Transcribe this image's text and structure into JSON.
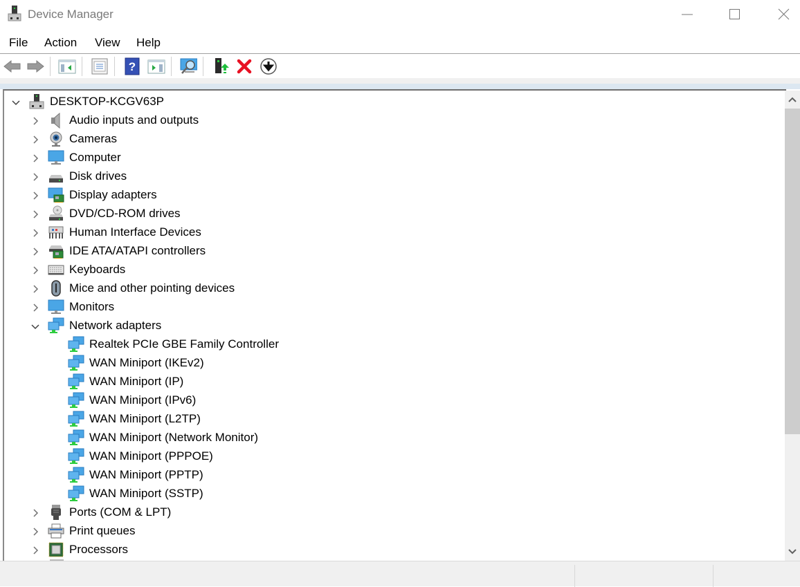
{
  "window": {
    "title": "Device Manager",
    "controls": {
      "minimize": "minimize",
      "maximize": "maximize",
      "close": "close"
    }
  },
  "menu": {
    "items": [
      "File",
      "Action",
      "View",
      "Help"
    ]
  },
  "toolbar": {
    "buttons": [
      {
        "name": "back",
        "icon": "back-arrow-icon"
      },
      {
        "name": "forward",
        "icon": "forward-arrow-icon"
      },
      {
        "name": "show-hide-console-tree",
        "icon": "console-tree-icon"
      },
      {
        "name": "properties",
        "icon": "properties-icon"
      },
      {
        "name": "help",
        "icon": "help-icon"
      },
      {
        "name": "show-hide-action-pane",
        "icon": "action-pane-icon"
      },
      {
        "name": "scan-hardware-changes",
        "icon": "scan-monitor-icon"
      },
      {
        "name": "update-driver",
        "icon": "update-driver-icon"
      },
      {
        "name": "uninstall-device",
        "icon": "red-x-icon"
      },
      {
        "name": "disable-device",
        "icon": "down-arrow-circle-icon"
      }
    ]
  },
  "tree": {
    "root": {
      "label": "DESKTOP-KCGV63P",
      "expanded": true,
      "icon": "computer-tower-icon"
    },
    "categories": [
      {
        "label": "Audio inputs and outputs",
        "icon": "speaker-icon",
        "expanded": false
      },
      {
        "label": "Cameras",
        "icon": "webcam-icon",
        "expanded": false
      },
      {
        "label": "Computer",
        "icon": "monitor-icon",
        "expanded": false
      },
      {
        "label": "Disk drives",
        "icon": "disk-drive-icon",
        "expanded": false
      },
      {
        "label": "Display adapters",
        "icon": "display-adapter-icon",
        "expanded": false
      },
      {
        "label": "DVD/CD-ROM drives",
        "icon": "dvd-drive-icon",
        "expanded": false
      },
      {
        "label": "Human Interface Devices",
        "icon": "hid-icon",
        "expanded": false
      },
      {
        "label": "IDE ATA/ATAPI controllers",
        "icon": "ide-controller-icon",
        "expanded": false
      },
      {
        "label": "Keyboards",
        "icon": "keyboard-icon",
        "expanded": false
      },
      {
        "label": "Mice and other pointing devices",
        "icon": "mouse-icon",
        "expanded": false
      },
      {
        "label": "Monitors",
        "icon": "monitor-icon",
        "expanded": false
      },
      {
        "label": "Network adapters",
        "icon": "network-adapter-icon",
        "expanded": true,
        "children": [
          "Realtek PCIe GBE Family Controller",
          "WAN Miniport (IKEv2)",
          "WAN Miniport (IP)",
          "WAN Miniport (IPv6)",
          "WAN Miniport (L2TP)",
          "WAN Miniport (Network Monitor)",
          "WAN Miniport (PPPOE)",
          "WAN Miniport (PPTP)",
          "WAN Miniport (SSTP)"
        ]
      },
      {
        "label": "Ports (COM & LPT)",
        "icon": "port-icon",
        "expanded": false
      },
      {
        "label": "Print queues",
        "icon": "printer-icon",
        "expanded": false
      },
      {
        "label": "Processors",
        "icon": "processor-icon",
        "expanded": false
      }
    ]
  },
  "scrollbar": {
    "position_fraction": 0.0,
    "visible_fraction": 0.75
  },
  "colors": {
    "accent": "#0078d7",
    "title_text": "#7a7a7a",
    "error_red": "#e81123"
  }
}
